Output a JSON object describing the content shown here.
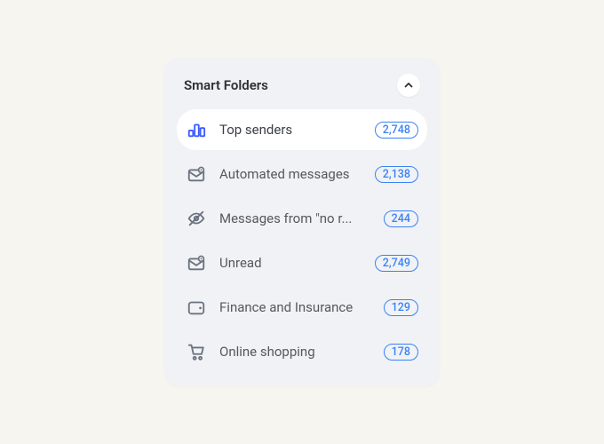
{
  "panel": {
    "title": "Smart Folders"
  },
  "folders": [
    {
      "label": "Top senders",
      "count": "2,748",
      "icon": "chart-bar",
      "selected": true
    },
    {
      "label": "Automated messages",
      "count": "2,138",
      "icon": "mail-gear",
      "selected": false
    },
    {
      "label": "Messages from \"no r...",
      "count": "244",
      "icon": "eye-off",
      "selected": false
    },
    {
      "label": "Unread",
      "count": "2,749",
      "icon": "mail-gear",
      "selected": false
    },
    {
      "label": "Finance and Insurance",
      "count": "129",
      "icon": "wallet",
      "selected": false
    },
    {
      "label": "Online shopping",
      "count": "178",
      "icon": "cart",
      "selected": false
    }
  ]
}
